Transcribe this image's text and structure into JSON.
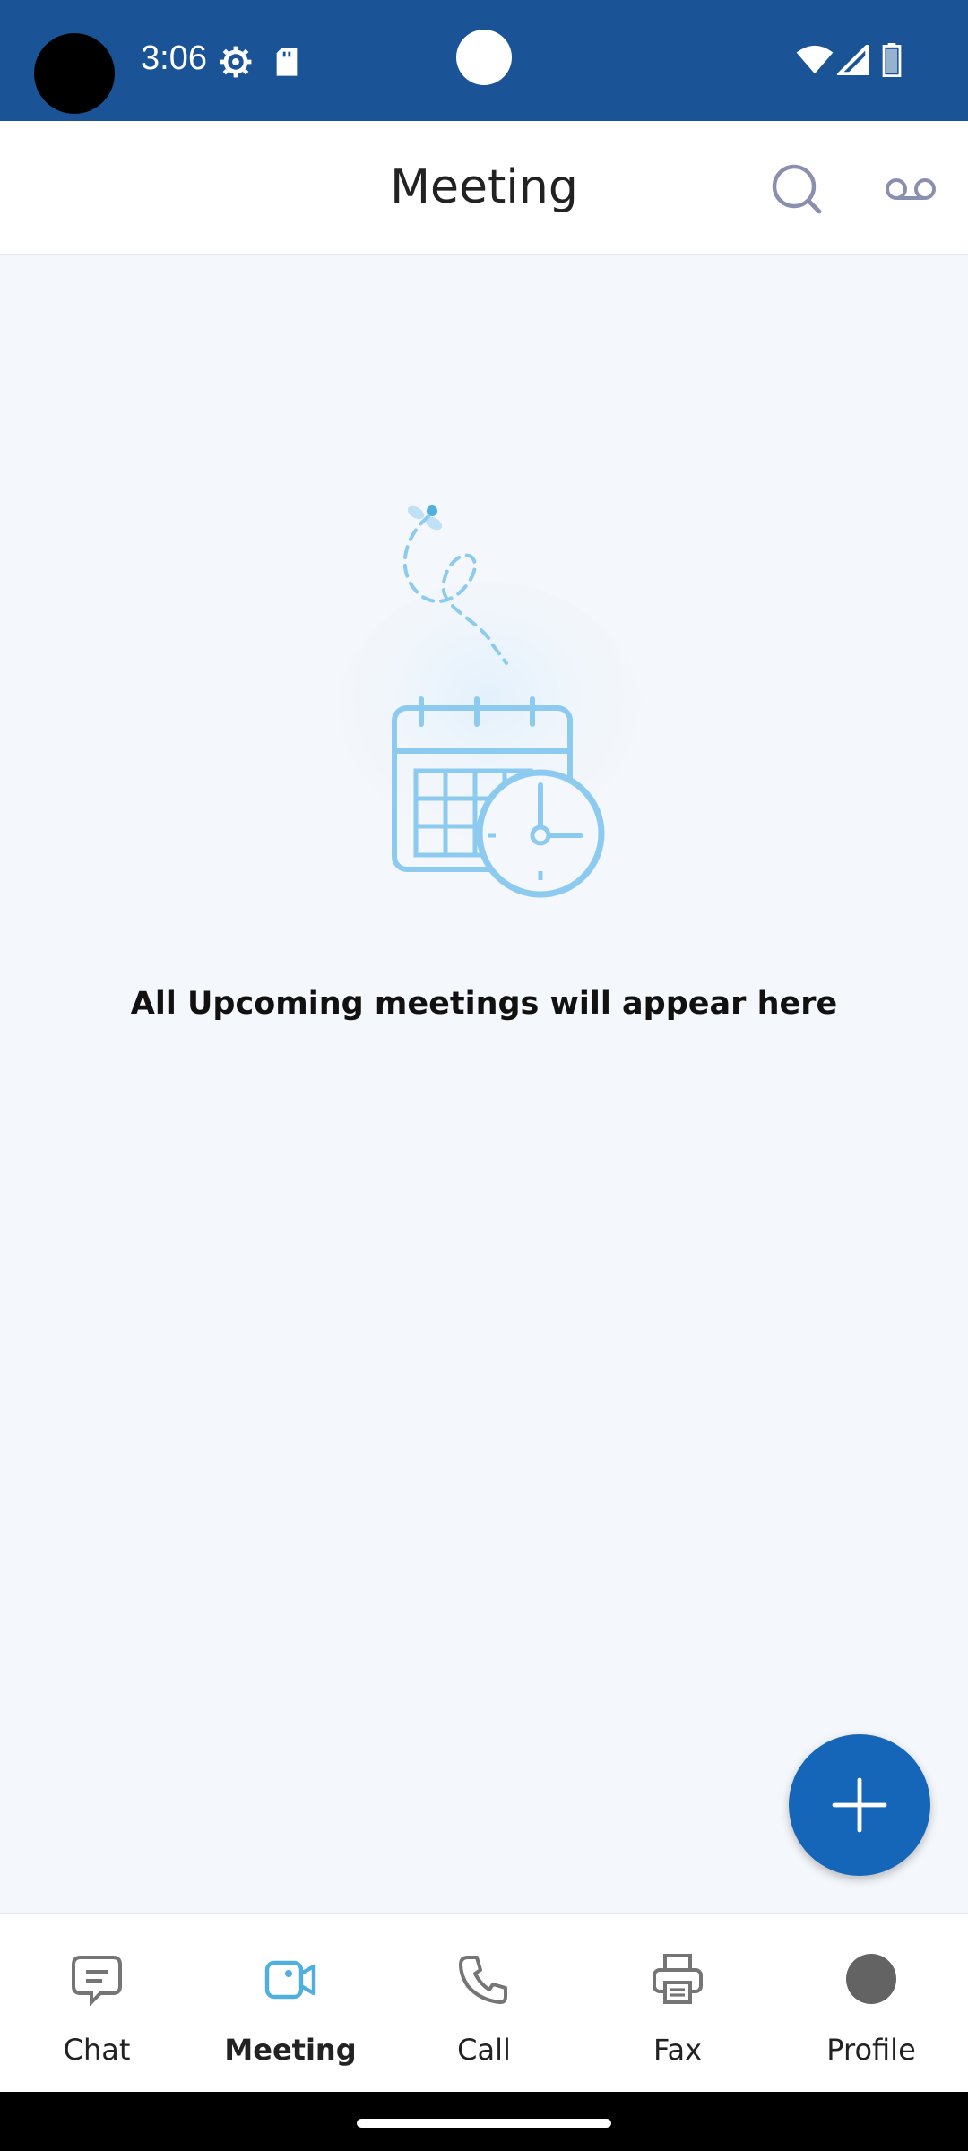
{
  "status_bar": {
    "time": "3:06",
    "icons": [
      "settings-gear-icon",
      "sd-card-icon",
      "wifi-icon",
      "cell-signal-icon",
      "battery-icon"
    ]
  },
  "header": {
    "title": "Meeting",
    "actions": [
      "search-icon",
      "voicemail-icon"
    ]
  },
  "empty_state": {
    "message": "All Upcoming meetings will appear here",
    "illustration": "calendar-clock-icon"
  },
  "fab": {
    "icon": "plus-icon"
  },
  "bottom_nav": {
    "items": [
      {
        "label": "Chat",
        "icon": "chat-icon",
        "active": false
      },
      {
        "label": "Meeting",
        "icon": "video-camera-icon",
        "active": true
      },
      {
        "label": "Call",
        "icon": "phone-icon",
        "active": false
      },
      {
        "label": "Fax",
        "icon": "printer-icon",
        "active": false
      },
      {
        "label": "Profile",
        "icon": "avatar-icon",
        "active": false
      }
    ]
  },
  "colors": {
    "status_bar": "#1a5496",
    "accent": "#1565b8",
    "active_icon": "#4fb0e0",
    "illustration": "#8ccbef",
    "background": "#f4f7fb"
  }
}
